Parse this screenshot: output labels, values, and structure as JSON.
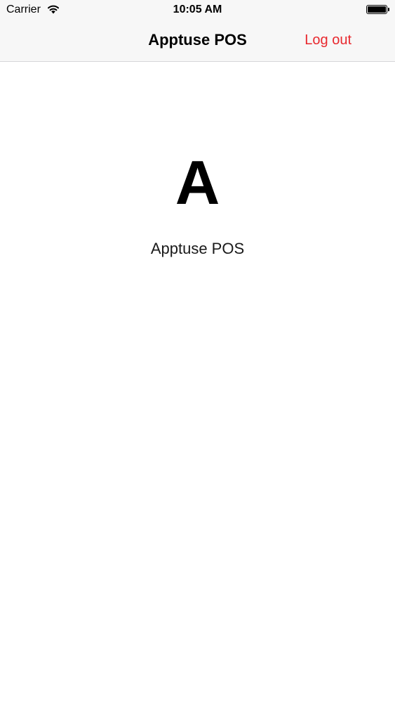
{
  "status_bar": {
    "carrier": "Carrier",
    "time": "10:05 AM",
    "wifi_icon": "wifi-icon",
    "battery_icon": "battery-icon"
  },
  "nav": {
    "title": "Apptuse POS",
    "logout_label": "Log out"
  },
  "main": {
    "logo_letter": "A",
    "app_name": "Apptuse POS"
  },
  "colors": {
    "accent": "#e8282e",
    "nav_background": "#f7f7f7",
    "background": "#ffffff"
  }
}
